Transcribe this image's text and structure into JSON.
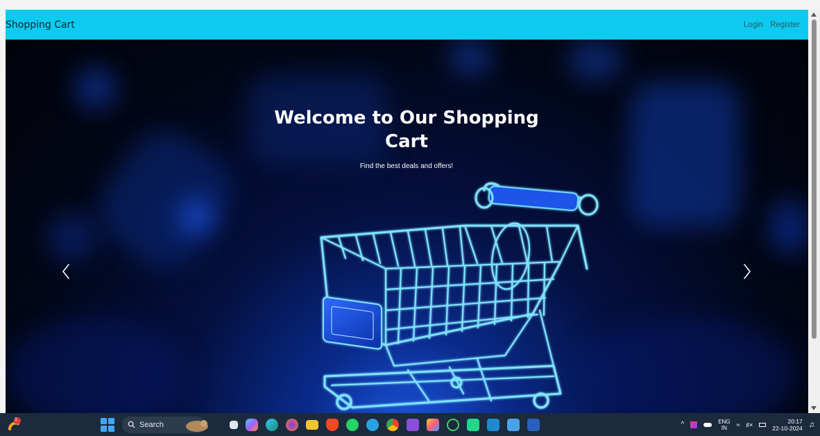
{
  "navbar": {
    "brand": "Shopping Cart",
    "links": [
      "Login",
      "Register"
    ]
  },
  "hero": {
    "title_line1": "Welcome to Our Shopping",
    "title_line2": "Cart",
    "subtitle": "Find the best deals and offers!",
    "prev_icon": "chevron-left-icon",
    "next_icon": "chevron-right-icon"
  },
  "taskbar": {
    "search_placeholder": "Search",
    "notification_count": "1",
    "apps": [
      "task-view",
      "copilot",
      "edge",
      "firefox",
      "file-explorer",
      "brave",
      "whatsapp",
      "telegram",
      "chrome",
      "visual-studio",
      "paint",
      "obs",
      "pycharm",
      "vscode",
      "notepad",
      "word"
    ],
    "tray": {
      "lang_line1": "ENG",
      "lang_line2": "IN",
      "time": "20:17",
      "date": "22-10-2024"
    }
  },
  "colors": {
    "navbar_bg": "#0dcaf0",
    "taskbar_bg": "#1b2a3d",
    "hero_glow": "#1b56e0"
  }
}
